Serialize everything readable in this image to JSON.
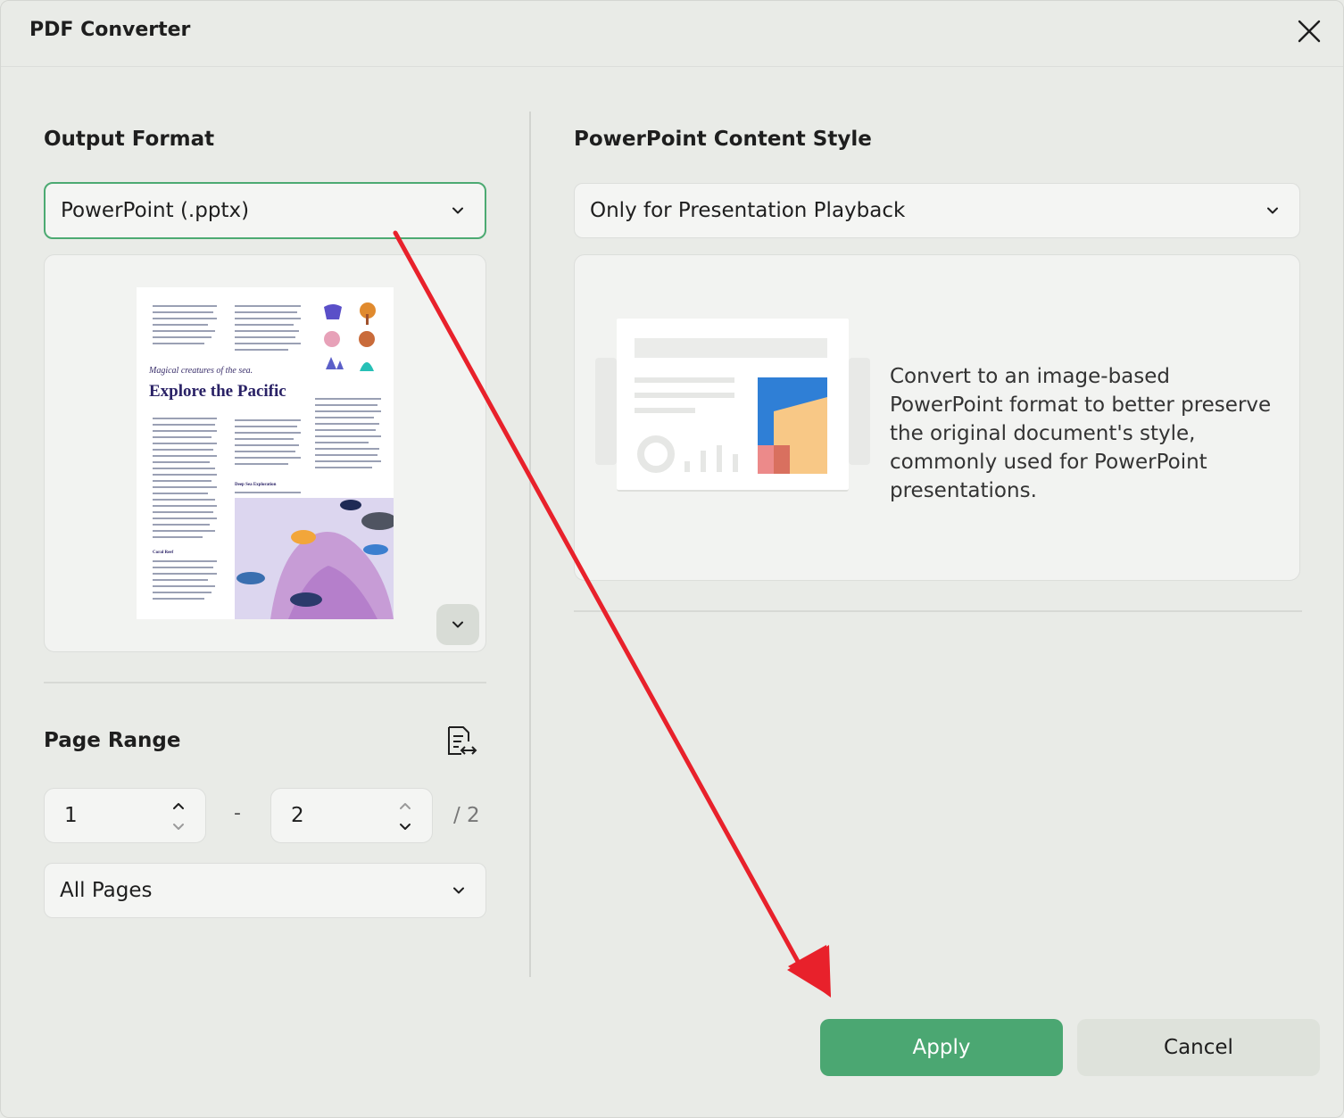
{
  "dialog": {
    "title": "PDF Converter"
  },
  "output_format": {
    "label": "Output Format",
    "selected": "PowerPoint (.pptx)"
  },
  "preview": {
    "doc_subtitle": "Magical creatures of the sea.",
    "doc_title": "Explore the Pacific",
    "doc_heading_deep": "Deep Sea Exploration",
    "doc_heading_coral": "Coral Reef"
  },
  "page_range": {
    "label": "Page Range",
    "from": "1",
    "dash": "-",
    "to": "2",
    "total": "/ 2",
    "subset": "All Pages"
  },
  "content_style": {
    "label": "PowerPoint Content Style",
    "selected": "Only for Presentation Playback",
    "description": "Convert to an image-based PowerPoint format to better preserve the original document's style, commonly used for PowerPoint presentations."
  },
  "actions": {
    "apply": "Apply",
    "cancel": "Cancel"
  },
  "colors": {
    "accent": "#4ba772",
    "annotation_arrow": "#e8212b"
  }
}
